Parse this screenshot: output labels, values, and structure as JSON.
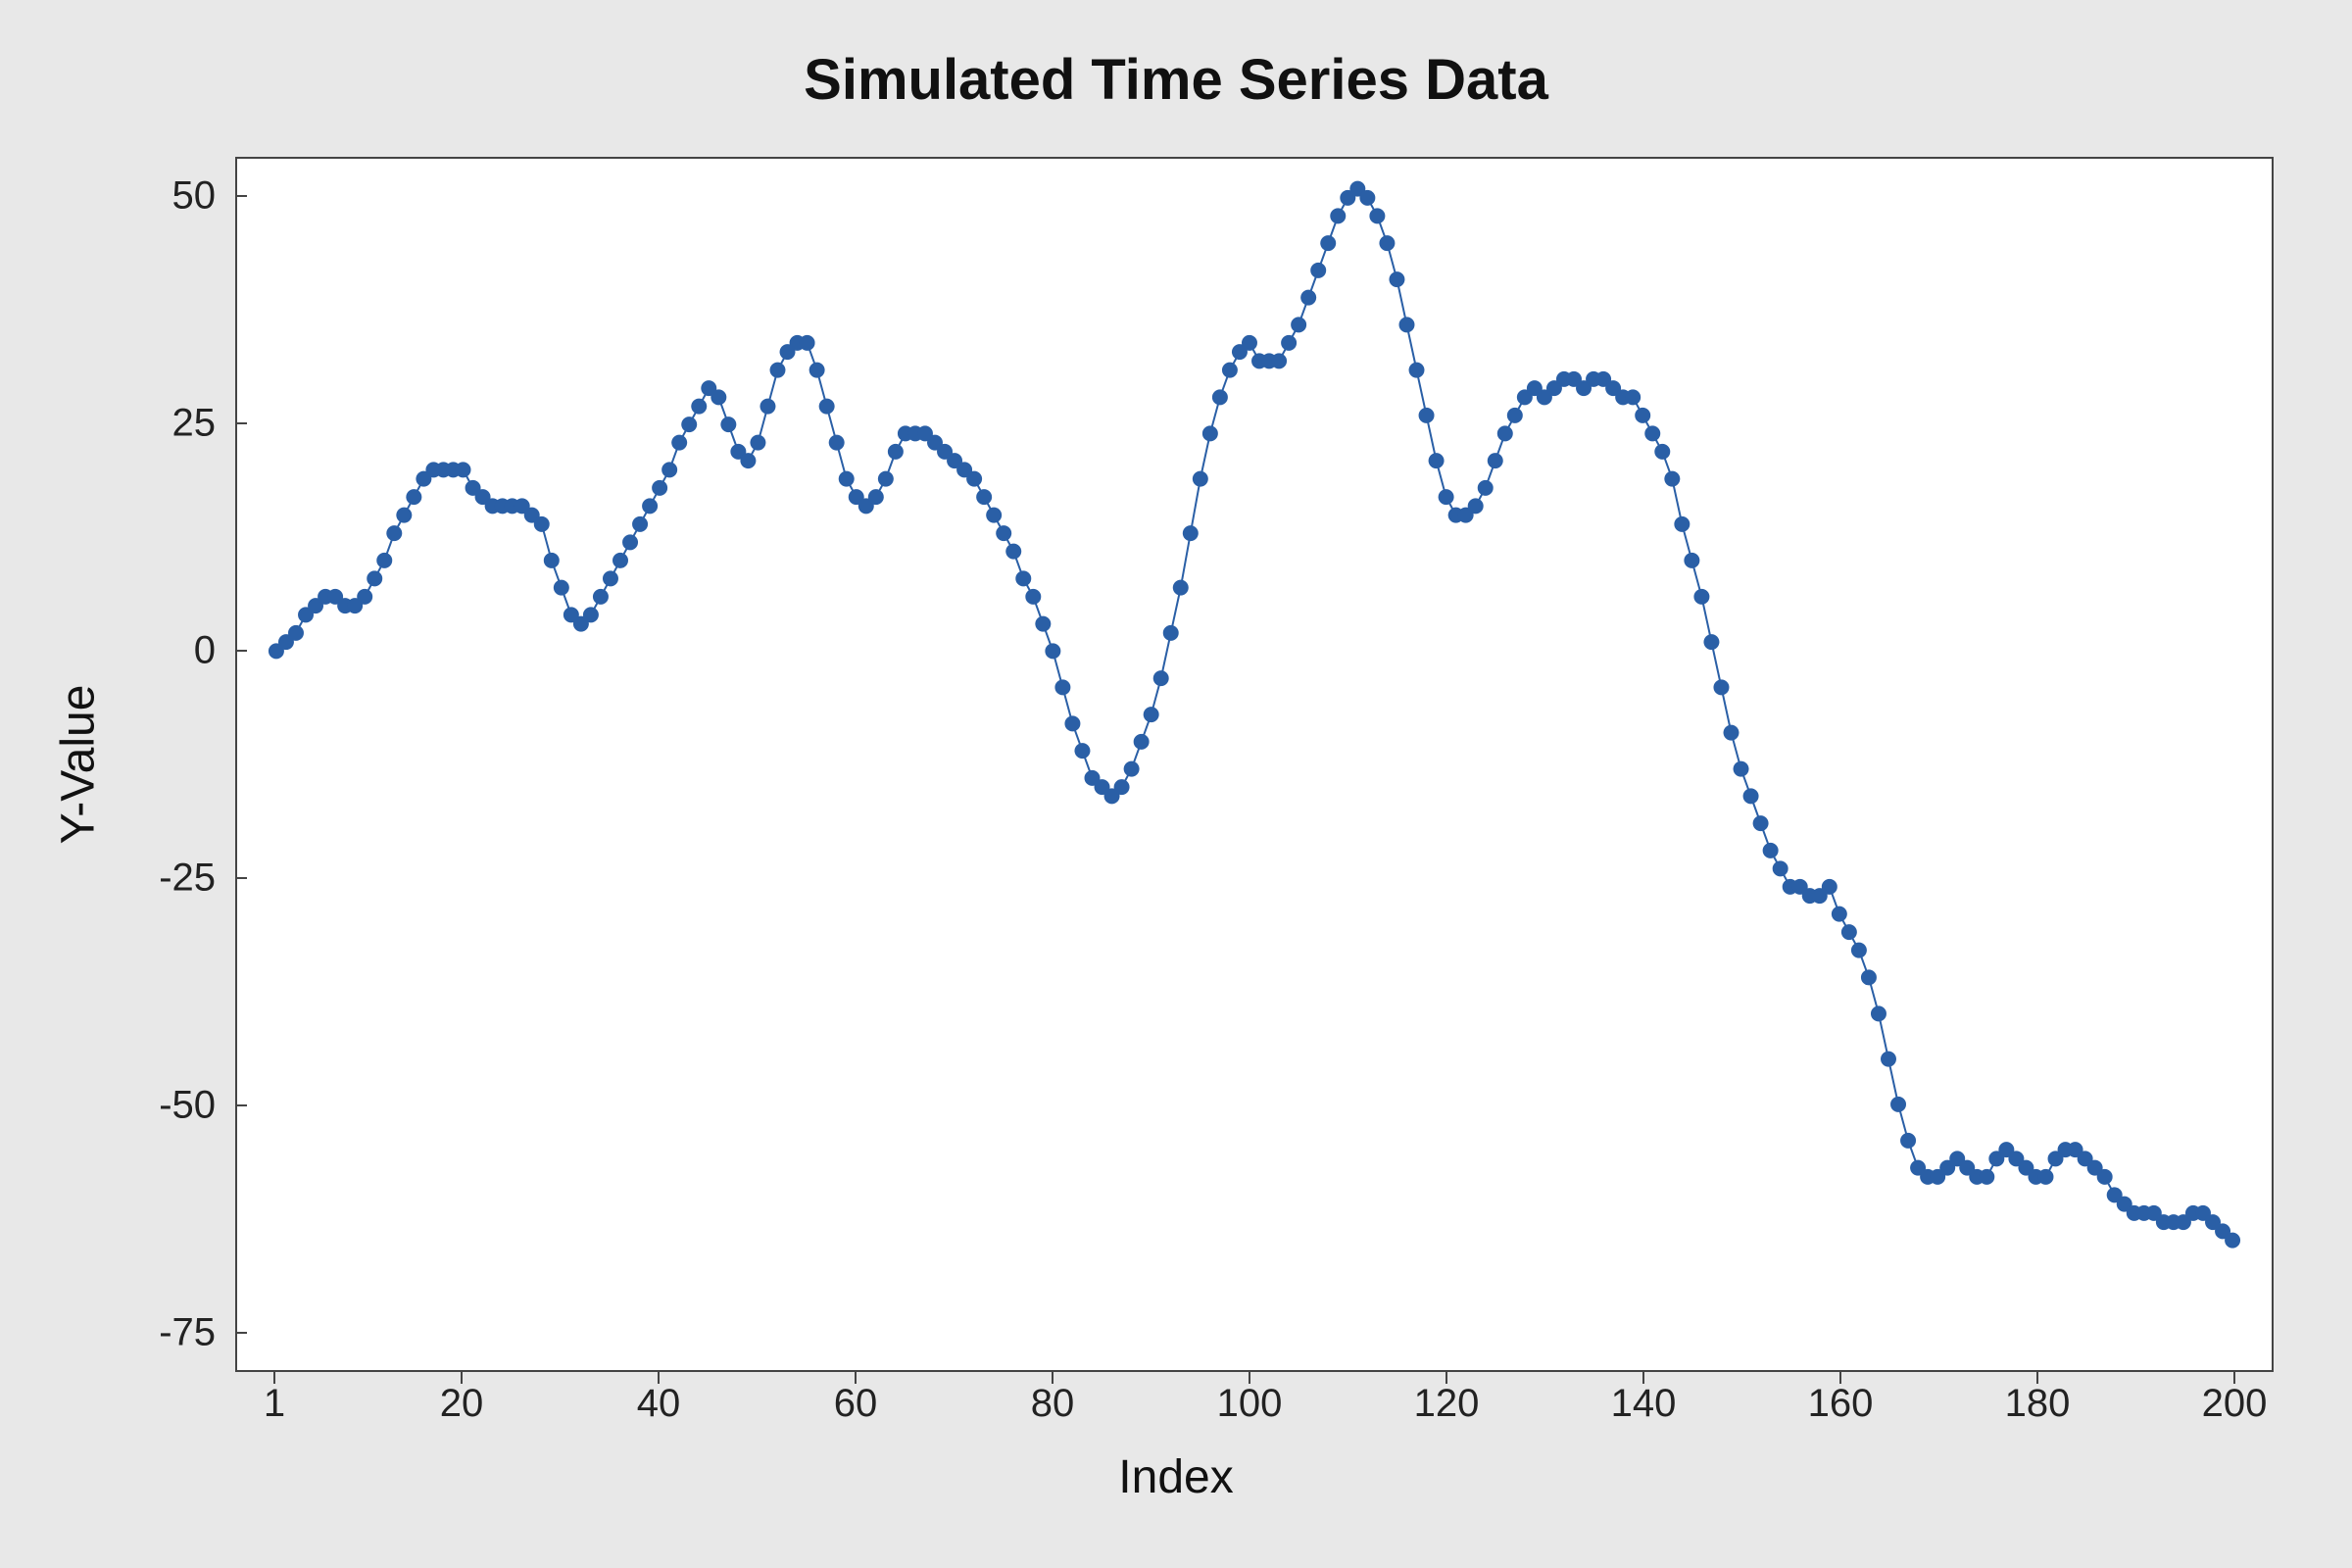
{
  "chart_data": {
    "type": "line",
    "title": "Simulated Time Series Data",
    "xlabel": "Index",
    "ylabel": "Y-Value",
    "xlim": [
      1,
      200
    ],
    "ylim": [
      -75,
      50
    ],
    "xticks": [
      1,
      20,
      40,
      60,
      80,
      100,
      120,
      140,
      160,
      180,
      200
    ],
    "yticks": [
      -75,
      -50,
      -25,
      0,
      25,
      50
    ],
    "x": [
      1,
      2,
      3,
      4,
      5,
      6,
      7,
      8,
      9,
      10,
      11,
      12,
      13,
      14,
      15,
      16,
      17,
      18,
      19,
      20,
      21,
      22,
      23,
      24,
      25,
      26,
      27,
      28,
      29,
      30,
      31,
      32,
      33,
      34,
      35,
      36,
      37,
      38,
      39,
      40,
      41,
      42,
      43,
      44,
      45,
      46,
      47,
      48,
      49,
      50,
      51,
      52,
      53,
      54,
      55,
      56,
      57,
      58,
      59,
      60,
      61,
      62,
      63,
      64,
      65,
      66,
      67,
      68,
      69,
      70,
      71,
      72,
      73,
      74,
      75,
      76,
      77,
      78,
      79,
      80,
      81,
      82,
      83,
      84,
      85,
      86,
      87,
      88,
      89,
      90,
      91,
      92,
      93,
      94,
      95,
      96,
      97,
      98,
      99,
      100,
      101,
      102,
      103,
      104,
      105,
      106,
      107,
      108,
      109,
      110,
      111,
      112,
      113,
      114,
      115,
      116,
      117,
      118,
      119,
      120,
      121,
      122,
      123,
      124,
      125,
      126,
      127,
      128,
      129,
      130,
      131,
      132,
      133,
      134,
      135,
      136,
      137,
      138,
      139,
      140,
      141,
      142,
      143,
      144,
      145,
      146,
      147,
      148,
      149,
      150,
      151,
      152,
      153,
      154,
      155,
      156,
      157,
      158,
      159,
      160,
      161,
      162,
      163,
      164,
      165,
      166,
      167,
      168,
      169,
      170,
      171,
      172,
      173,
      174,
      175,
      176,
      177,
      178,
      179,
      180,
      181,
      182,
      183,
      184,
      185,
      186,
      187,
      188,
      189,
      190,
      191,
      192,
      193,
      194,
      195,
      196,
      197,
      198,
      199,
      200
    ],
    "values": [
      0,
      1,
      2,
      4,
      5,
      6,
      6,
      5,
      5,
      6,
      8,
      10,
      13,
      15,
      17,
      19,
      20,
      20,
      20,
      20,
      18,
      17,
      16,
      16,
      16,
      16,
      15,
      14,
      10,
      7,
      4,
      3,
      4,
      6,
      8,
      10,
      12,
      14,
      16,
      18,
      20,
      23,
      25,
      27,
      29,
      28,
      25,
      22,
      21,
      23,
      27,
      31,
      33,
      34,
      34,
      31,
      27,
      23,
      19,
      17,
      16,
      17,
      19,
      22,
      24,
      24,
      24,
      23,
      22,
      21,
      20,
      19,
      17,
      15,
      13,
      11,
      8,
      6,
      3,
      0,
      -4,
      -8,
      -11,
      -14,
      -15,
      -16,
      -15,
      -13,
      -10,
      -7,
      -3,
      2,
      7,
      13,
      19,
      24,
      28,
      31,
      33,
      34,
      32,
      32,
      32,
      34,
      36,
      39,
      42,
      45,
      48,
      50,
      51,
      50,
      48,
      45,
      41,
      36,
      31,
      26,
      21,
      17,
      15,
      15,
      16,
      18,
      21,
      24,
      26,
      28,
      29,
      28,
      29,
      30,
      30,
      29,
      30,
      30,
      29,
      28,
      28,
      26,
      24,
      22,
      19,
      14,
      10,
      6,
      1,
      -4,
      -9,
      -13,
      -16,
      -19,
      -22,
      -24,
      -26,
      -26,
      -27,
      -27,
      -26,
      -29,
      -31,
      -33,
      -36,
      -40,
      -45,
      -50,
      -54,
      -57,
      -58,
      -58,
      -57,
      -56,
      -57,
      -58,
      -58,
      -56,
      -55,
      -56,
      -57,
      -58,
      -58,
      -56,
      -55,
      -55,
      -56,
      -57,
      -58,
      -60,
      -61,
      -62,
      -62,
      -62,
      -63,
      -63,
      -63,
      -62,
      -62,
      -63,
      -64,
      -65
    ]
  }
}
